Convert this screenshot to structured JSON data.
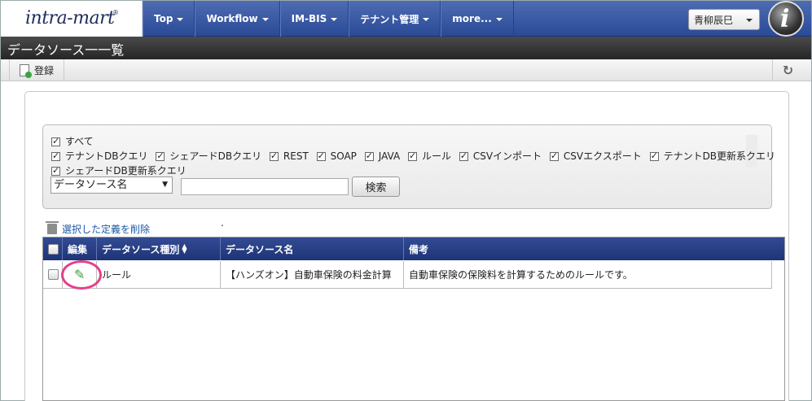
{
  "nav": {
    "logo": "intra-mart",
    "logo_reg": "®",
    "items": [
      {
        "label": "Top"
      },
      {
        "label": "Workflow"
      },
      {
        "label": "IM-BIS"
      },
      {
        "label": "テナント管理"
      },
      {
        "label": "more..."
      }
    ],
    "user": "青柳辰巳",
    "app_icon": "i"
  },
  "page": {
    "title": "データソース一一覧"
  },
  "toolbar": {
    "register": "登録",
    "refresh_icon": "refresh-icon"
  },
  "search": {
    "checkboxes": [
      {
        "label": "すべて",
        "checked": true
      },
      {
        "label": "テナントDBクエリ",
        "checked": true
      },
      {
        "label": "シェアードDBクエリ",
        "checked": true
      },
      {
        "label": "REST",
        "checked": true
      },
      {
        "label": "SOAP",
        "checked": true
      },
      {
        "label": "JAVA",
        "checked": true
      },
      {
        "label": "ルール",
        "checked": true
      },
      {
        "label": "CSVインポート",
        "checked": true
      },
      {
        "label": "CSVエクスポート",
        "checked": true
      },
      {
        "label": "テナントDB更新系クエリ",
        "checked": true
      },
      {
        "label": "シェアードDB更新系クエリ",
        "checked": true
      }
    ],
    "select_value": "データソース名",
    "input_value": "",
    "button": "検索"
  },
  "actions": {
    "delete_selected": "選択した定義を削除",
    "dot": "."
  },
  "table": {
    "headers": [
      "編集",
      "データソース種別",
      "データソース名",
      "備考"
    ],
    "rows": [
      {
        "type": "ルール",
        "name": "【ハンズオン】自動車保険の料金計算",
        "note": "自動車保険の保険料を計算するためのルールです。"
      }
    ]
  }
}
